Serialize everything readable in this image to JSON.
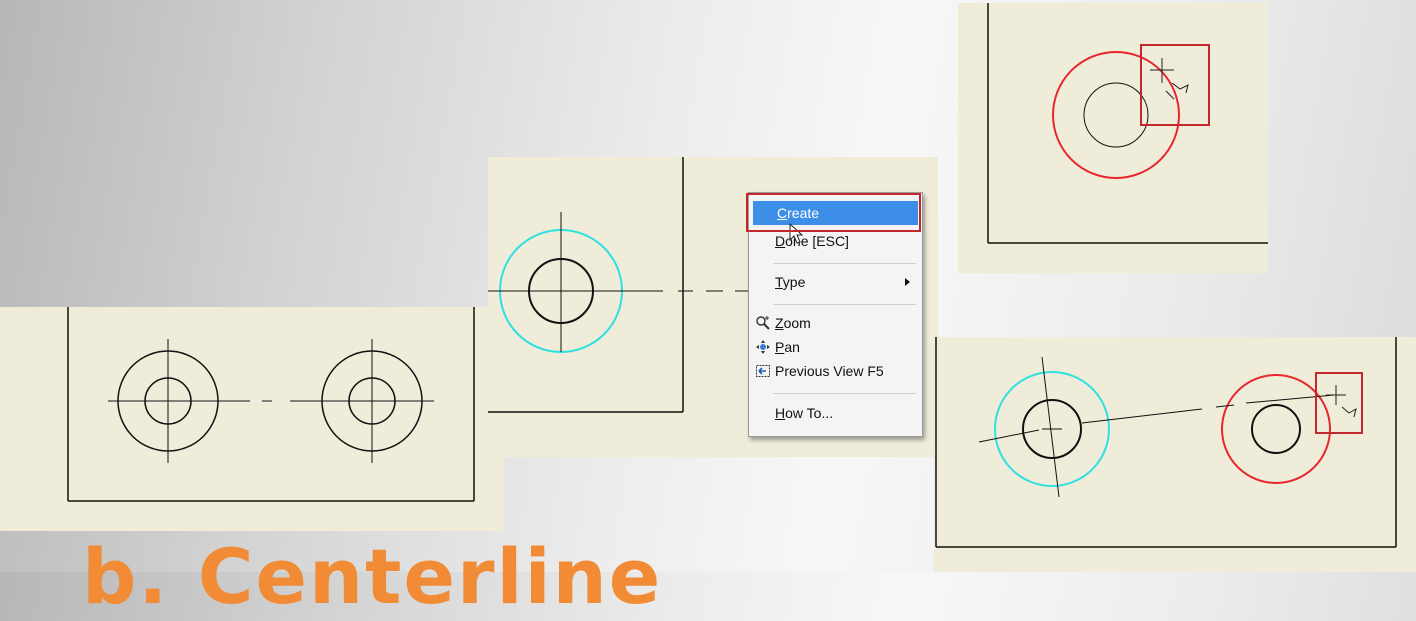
{
  "menu": {
    "items": [
      {
        "label": "Create",
        "underline": "C",
        "rest": "reate",
        "icon": null,
        "highlighted": true
      },
      {
        "label": "Done [ESC]",
        "underline": "D",
        "rest": "one [ESC]",
        "icon": null
      },
      {
        "label": "Type",
        "underline": "T",
        "rest": "ype",
        "icon": null,
        "submenu": true
      },
      {
        "label": "Zoom",
        "underline": "Z",
        "rest": "oom",
        "icon": "zoom-icon"
      },
      {
        "label": "Pan",
        "underline": "P",
        "rest": "an",
        "icon": "pan-icon"
      },
      {
        "label": "Previous View F5",
        "underline": "",
        "rest": "Previous View F5",
        "icon": "previous-view-icon"
      },
      {
        "label": "How To...",
        "underline": "H",
        "rest": "ow To...",
        "icon": null
      }
    ]
  },
  "slide_title": "b. Centerline",
  "colors": {
    "title_orange": "#f28b35",
    "panel_bg": "#efecda",
    "highlight_blue": "#3d8ee6",
    "highlight_red": "#c3272e",
    "circle_cyan": "#2ee0e0",
    "circle_red": "#e8262c"
  }
}
